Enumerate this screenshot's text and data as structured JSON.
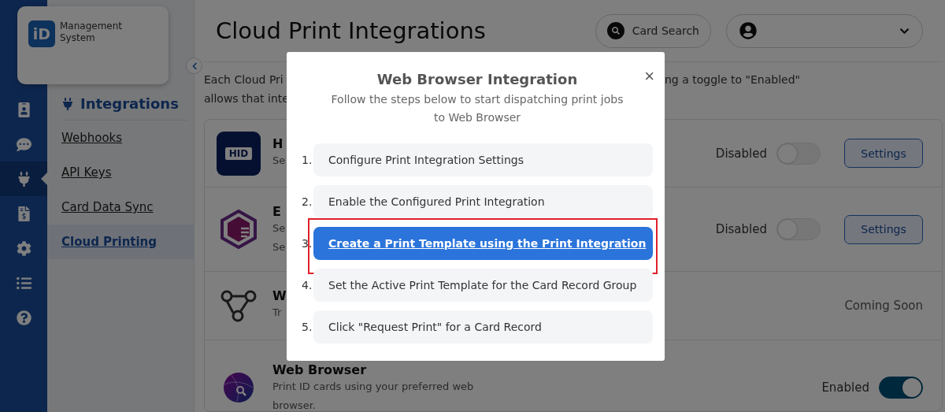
{
  "logo": {
    "mark": "iD",
    "name": "Management System"
  },
  "rail": [
    {
      "selected": false
    },
    {
      "selected": false
    },
    {
      "selected": true
    },
    {
      "selected": false
    },
    {
      "selected": false
    },
    {
      "selected": false
    },
    {
      "selected": false
    }
  ],
  "subnav": {
    "heading": "Integrations",
    "items": [
      {
        "label": "Webhooks",
        "selected": false
      },
      {
        "label": "API Keys",
        "selected": false
      },
      {
        "label": "Card Data Sync",
        "selected": false
      },
      {
        "label": "Cloud Printing",
        "selected": true
      }
    ]
  },
  "header": {
    "title": "Cloud Print Integrations",
    "search_button": "Card Search"
  },
  "intro": {
    "left_lines": [
      "Each Cloud Pri",
      "allows that inte"
    ],
    "right_text": "ng a toggle to \"Enabled\""
  },
  "integrations": [
    {
      "logo_text": "HID",
      "title": "H",
      "description": [
        "Se"
      ],
      "kind": "toggle",
      "status": "Disabled",
      "on": false,
      "button": "Settings"
    },
    {
      "title": "E",
      "description": [
        "Se",
        "Se"
      ],
      "kind": "toggle",
      "status": "Disabled",
      "on": false,
      "button": "Settings"
    },
    {
      "title": "W",
      "description": [
        "Tr"
      ],
      "kind": "soon",
      "status": "Coming Soon"
    },
    {
      "title": "Web Browser",
      "description": [
        "Print ID cards using your preferred web browser."
      ],
      "kind": "toggle",
      "status": "Enabled",
      "on": true
    }
  ],
  "modal": {
    "title": "Web Browser Integration",
    "subtitle": "Follow the steps below to start dispatching print jobs to Web Browser",
    "close": "×",
    "steps": [
      {
        "number": "1.",
        "label": "Configure Print Integration Settings",
        "selected": false
      },
      {
        "number": "2.",
        "label": "Enable the Configured Print Integration",
        "selected": false
      },
      {
        "number": "3.",
        "label": "Create a Print Template using the Print Integration",
        "selected": true
      },
      {
        "number": "4.",
        "label": "Set the Active Print Template for the Card Record Group",
        "selected": false
      },
      {
        "number": "5.",
        "label": "Click \"Request Print\" for a Card Record",
        "selected": false
      }
    ]
  }
}
